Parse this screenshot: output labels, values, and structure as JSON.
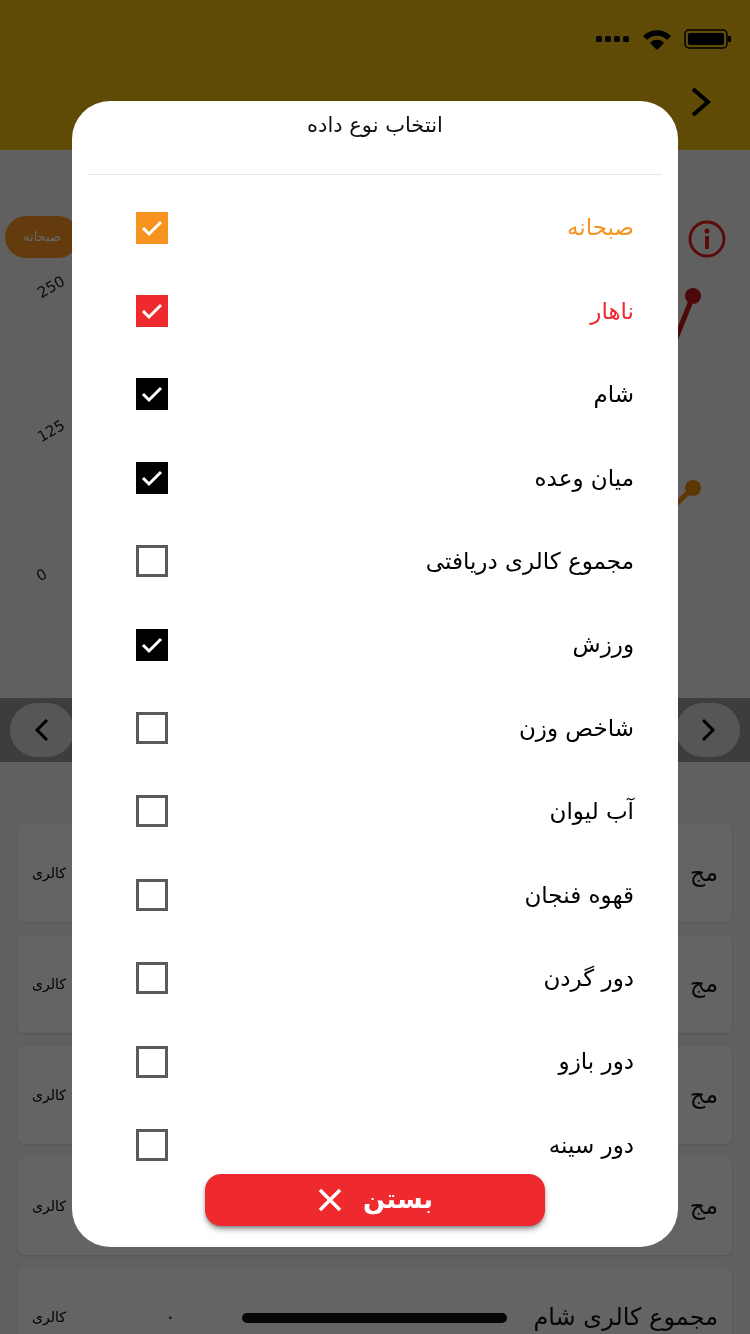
{
  "chart": {
    "legend": "صبحانه",
    "yticks": [
      "250",
      "125",
      "0"
    ]
  },
  "cards": [
    {
      "title": "مج",
      "unit": "کالری"
    },
    {
      "title": "مج",
      "unit": "کالری"
    },
    {
      "title": "مج",
      "unit": "کالری"
    },
    {
      "title": "مج",
      "unit": "کالری"
    },
    {
      "title": "مجموع کالری شام",
      "unit": "کالری",
      "value": "٠"
    }
  ],
  "dialog": {
    "title": "انتخاب نوع داده",
    "options": [
      {
        "label": "صبحانه",
        "checked": true,
        "color": "#f7931e"
      },
      {
        "label": "ناهار",
        "checked": true,
        "color": "#ee2a2e"
      },
      {
        "label": "شام",
        "checked": true,
        "color": "#000000"
      },
      {
        "label": "میان وعده",
        "checked": true,
        "color": "#000000"
      },
      {
        "label": "مجموع کالری دریافتی",
        "checked": false,
        "color": "#000000"
      },
      {
        "label": "ورزش",
        "checked": true,
        "color": "#000000"
      },
      {
        "label": "شاخص وزن",
        "checked": false,
        "color": "#000000"
      },
      {
        "label": "آب لیوان",
        "checked": false,
        "color": "#000000"
      },
      {
        "label": "قهوه فنجان",
        "checked": false,
        "color": "#000000"
      },
      {
        "label": "دور گردن",
        "checked": false,
        "color": "#000000"
      },
      {
        "label": "دور بازو",
        "checked": false,
        "color": "#000000"
      },
      {
        "label": "دور سینه",
        "checked": false,
        "color": "#000000"
      }
    ],
    "close_button": "بستن"
  }
}
